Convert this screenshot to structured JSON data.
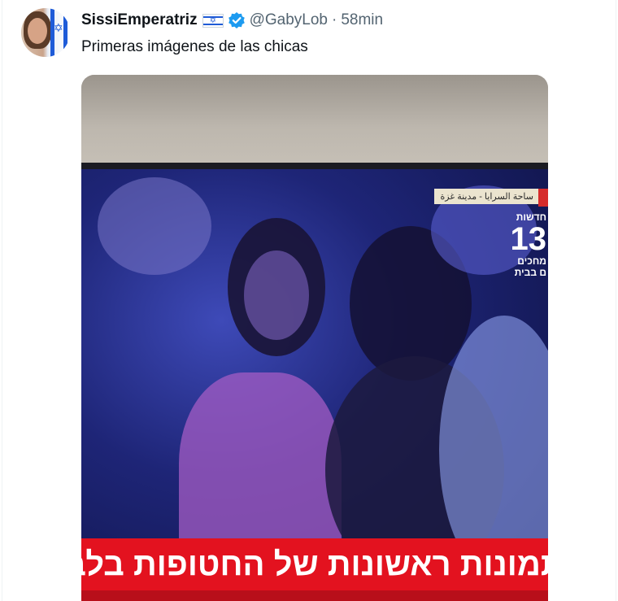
{
  "tweet": {
    "display_name": "SissiEmperatriz",
    "flag_glyph": "✡",
    "handle": "@GabyLob",
    "separator": "·",
    "time": "58min",
    "text": "Primeras imágenes de las chicas"
  },
  "media": {
    "corner_tag": "ساحة السرايا - مدينة غزة",
    "logo_top": "חדשות",
    "logo_number": "13",
    "logo_bottom_line1": "מחכים",
    "logo_bottom_line2": "ם בבית",
    "ticker_text": "תמונות ראשונות של החטופות בלב"
  },
  "colors": {
    "verified_blue": "#1d9bf0",
    "ticker_red": "#e3121f",
    "text_primary": "#0f1419",
    "text_secondary": "#536471"
  }
}
